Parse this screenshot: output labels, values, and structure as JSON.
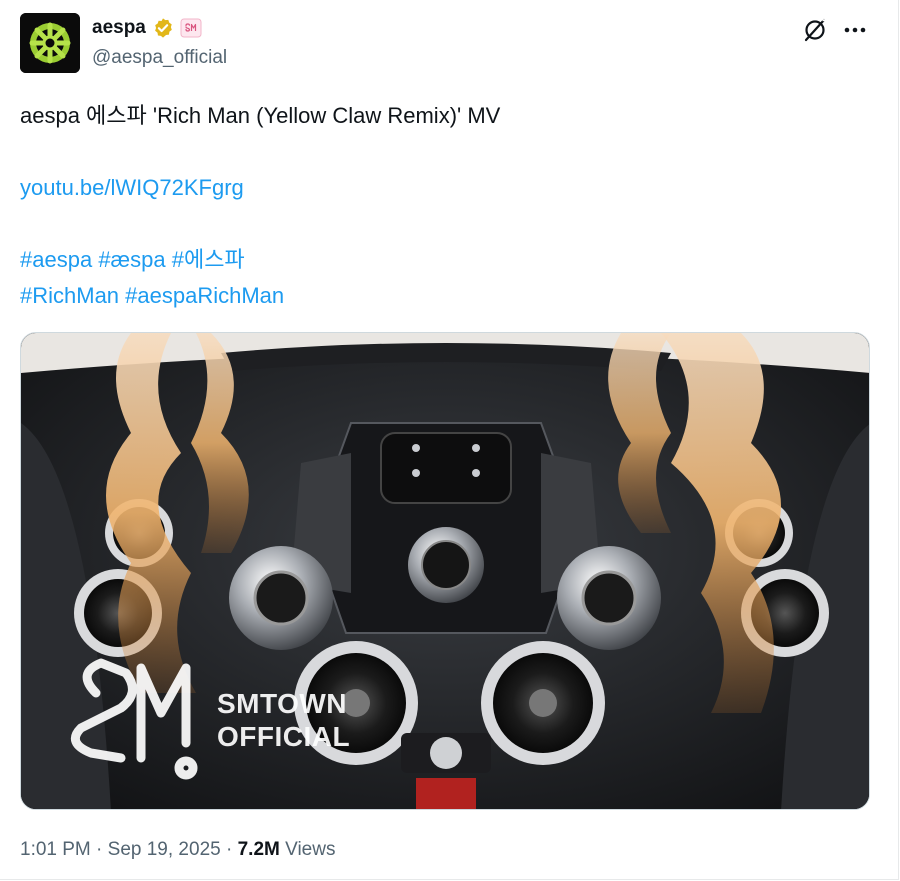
{
  "author": {
    "display_name": "aespa",
    "handle": "@aespa_official",
    "verified_badge": "verified-gold-badge-icon",
    "affiliate_badge": "sm-affiliate-badge-icon"
  },
  "header_actions": {
    "grok_icon": "grok-icon",
    "more_icon": "more-horizontal-icon"
  },
  "tweet": {
    "text": "aespa 에스파 'Rich Man (Yellow Claw Remix)' MV",
    "link": "youtu.be/lWIQ72KFgrg",
    "hashtags_line1": [
      "#aespa",
      "#æspa",
      "#에스파"
    ],
    "hashtags_line2": [
      "#RichMan",
      "#aespaRichMan"
    ]
  },
  "media": {
    "watermark_line1": "SMTOWN",
    "watermark_line2": "OFFICIAL"
  },
  "footer": {
    "time": "1:01 PM",
    "separator": " · ",
    "date": "Sep 19, 2025",
    "views_count": "7.2M",
    "views_label": "Views"
  },
  "colors": {
    "link": "#1d9bf0",
    "muted": "#536471",
    "text": "#0f1419",
    "badge_gold": "#e2b719"
  }
}
